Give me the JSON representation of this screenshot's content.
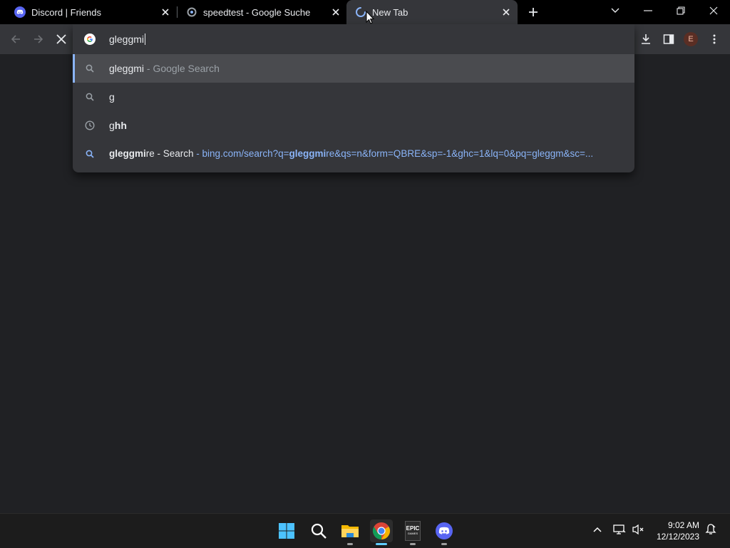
{
  "browser": {
    "tabs": [
      {
        "title": "Discord | Friends",
        "icon": "discord-icon",
        "active": false
      },
      {
        "title": "speedtest - Google Suche",
        "icon": "google-loading-icon",
        "active": false
      },
      {
        "title": "New Tab",
        "icon": "loading-spinner-icon",
        "active": true
      }
    ],
    "new_tab_icon": "plus-icon",
    "window_controls": [
      "tab-search-icon",
      "minimize-icon",
      "restore-icon",
      "close-icon"
    ]
  },
  "toolbar": {
    "back_icon": "arrow-left-icon",
    "forward_icon": "arrow-right-icon",
    "stop_icon": "stop-x-icon",
    "right_icons": [
      "download-icon",
      "side-panel-icon",
      "profile-avatar",
      "menu-kebab-icon"
    ],
    "profile_initial": "E"
  },
  "omnibox": {
    "input_value": "gleggmi",
    "suggestions": [
      {
        "icon": "search-icon",
        "bold": "",
        "plain": "gleggmi",
        "suffix": " - Google Search",
        "selected": true
      },
      {
        "icon": "search-icon",
        "bold": "",
        "plain": "g",
        "suffix": "",
        "selected": false
      },
      {
        "icon": "history-clock-icon",
        "plain_prefix": "g",
        "bold": "hh",
        "selected": false
      },
      {
        "icon": "bing-search-icon",
        "bold": "gleggmi",
        "plain": "re - Search",
        "url_prefix": " - bing.com/search?q=",
        "url_bold": "gleggmi",
        "url_rest": "re&qs=n&form=QBRE&sp=-1&ghc=1&lq=0&pq=gleggm&sc=..."
      }
    ]
  },
  "taskbar": {
    "apps": [
      "windows-start-icon",
      "search-icon",
      "file-explorer-icon",
      "chrome-icon",
      "epic-games-icon",
      "discord-icon"
    ],
    "epic_label": "EPIC",
    "epic_sub": "GAMES",
    "tray_icons": [
      "chevron-up-icon",
      "network-icon",
      "volume-muted-icon",
      "notification-bell-icon"
    ],
    "time": "9:02 AM",
    "date": "12/12/2023"
  },
  "colors": {
    "accent_blue": "#8ab4f8",
    "tab_strip": "#000000",
    "toolbar": "#35363a",
    "page": "#202124"
  }
}
